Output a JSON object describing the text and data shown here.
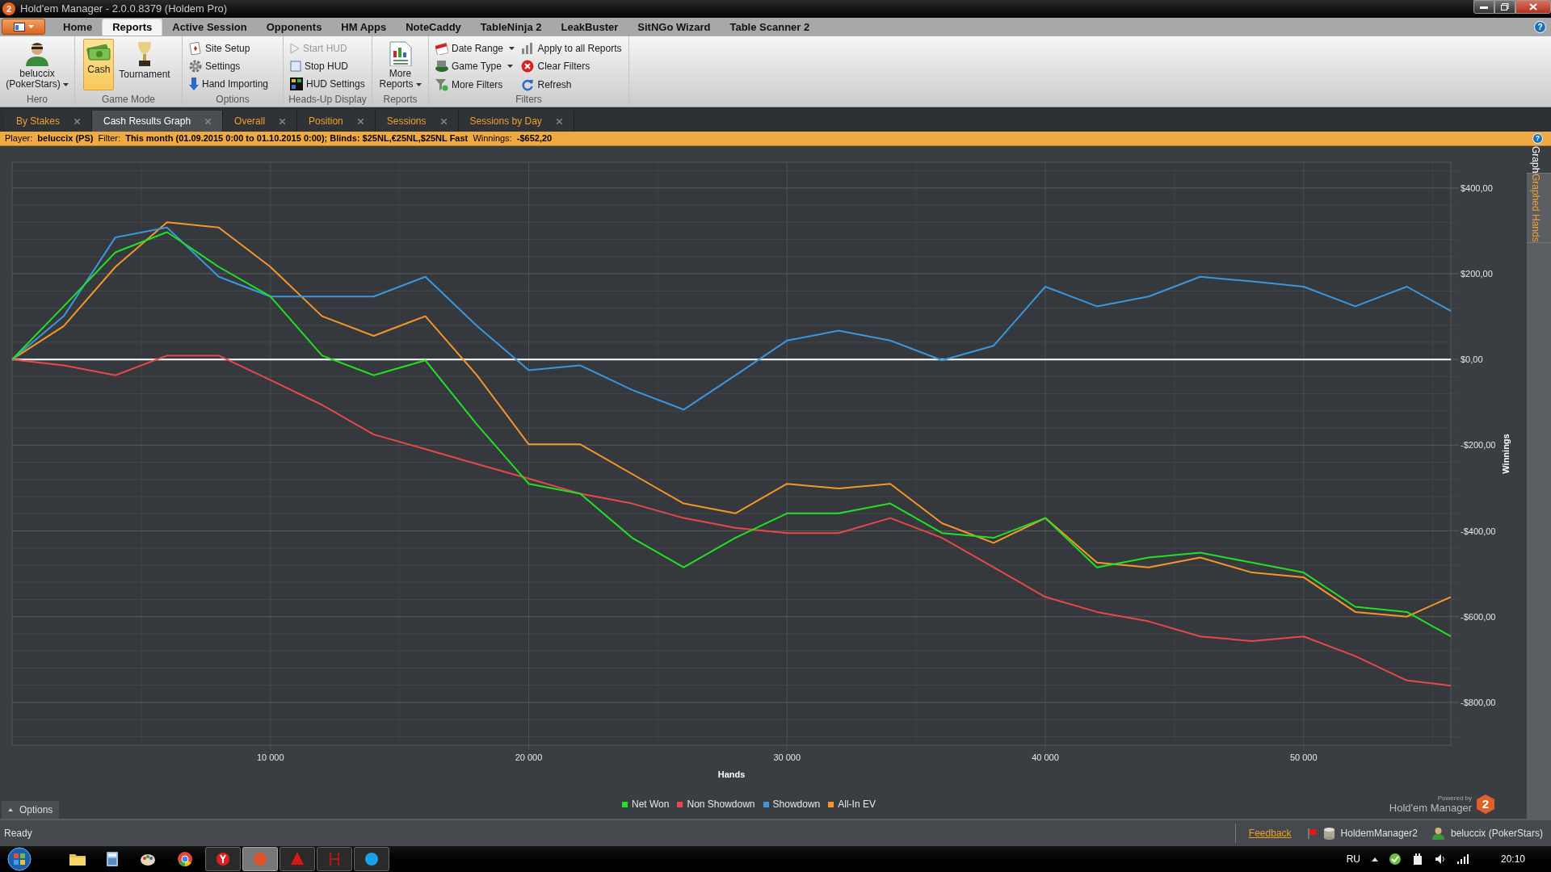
{
  "window": {
    "title": "Hold'em Manager - 2.0.0.8379 (Holdem Pro)",
    "icon_badge": "2"
  },
  "menu_tabs": [
    {
      "label": "Home",
      "selected": false
    },
    {
      "label": "Reports",
      "selected": true
    },
    {
      "label": "Active Session",
      "selected": false
    },
    {
      "label": "Opponents",
      "selected": false
    },
    {
      "label": "HM Apps",
      "selected": false
    },
    {
      "label": "NoteCaddy",
      "selected": false
    },
    {
      "label": "TableNinja 2",
      "selected": false
    },
    {
      "label": "LeakBuster",
      "selected": false
    },
    {
      "label": "SitNGo Wizard",
      "selected": false
    },
    {
      "label": "Table Scanner 2",
      "selected": false
    }
  ],
  "menu_help": "?",
  "ribbon": [
    {
      "label": "Hero",
      "items": [
        {
          "label": "beluccix (PokerStars)",
          "kind": "large",
          "dropdown": true,
          "selected": false,
          "disabled": false
        }
      ]
    },
    {
      "label": "Game Mode",
      "items": [
        {
          "label": "Cash",
          "kind": "large",
          "dropdown": false,
          "selected": true,
          "disabled": false
        },
        {
          "label": "Tournament",
          "kind": "large",
          "dropdown": false,
          "selected": false,
          "disabled": false
        }
      ]
    },
    {
      "label": "Options",
      "items": [
        {
          "label": "Site Setup",
          "kind": "small",
          "dropdown": false,
          "selected": false,
          "disabled": false
        },
        {
          "label": "Settings",
          "kind": "small",
          "dropdown": false,
          "selected": false,
          "disabled": false
        },
        {
          "label": "Hand Importing",
          "kind": "small",
          "dropdown": false,
          "selected": false,
          "disabled": false
        }
      ]
    },
    {
      "label": "Heads-Up Display",
      "items": [
        {
          "label": "Start HUD",
          "kind": "small",
          "dropdown": false,
          "selected": false,
          "disabled": true
        },
        {
          "label": "Stop HUD",
          "kind": "small",
          "dropdown": false,
          "selected": false,
          "disabled": false
        },
        {
          "label": "HUD Settings",
          "kind": "small",
          "dropdown": false,
          "selected": false,
          "disabled": false
        }
      ]
    },
    {
      "label": "Reports",
      "items": [
        {
          "label": "More Reports",
          "kind": "large",
          "dropdown": true,
          "selected": false,
          "disabled": false
        }
      ]
    },
    {
      "label": "Filters",
      "items": [
        {
          "label": "Date Range",
          "kind": "small",
          "dropdown": true,
          "selected": false,
          "disabled": false
        },
        {
          "label": "Game Type",
          "kind": "small",
          "dropdown": true,
          "selected": false,
          "disabled": false
        },
        {
          "label": "More Filters",
          "kind": "small",
          "dropdown": false,
          "selected": false,
          "disabled": false
        },
        {
          "label": "Apply to all Reports",
          "kind": "small",
          "dropdown": false,
          "selected": false,
          "disabled": false
        },
        {
          "label": "Clear Filters",
          "kind": "small",
          "dropdown": false,
          "selected": false,
          "disabled": false
        },
        {
          "label": "Refresh",
          "kind": "small",
          "dropdown": false,
          "selected": false,
          "disabled": false
        }
      ]
    }
  ],
  "doc_tabs": [
    {
      "label": "By Stakes",
      "selected": false
    },
    {
      "label": "Cash Results Graph",
      "selected": true
    },
    {
      "label": "Overall",
      "selected": false
    },
    {
      "label": "Position",
      "selected": false
    },
    {
      "label": "Sessions",
      "selected": false
    },
    {
      "label": "Sessions by Day",
      "selected": false
    }
  ],
  "filter_bar": {
    "text": "Player:  **beluccix (PS)**  Filter:  **This month (01.09.2015 0:00 to 01.10.2015 0:00); Blinds: $25NL,€25NL,$25NL Fast**  Winnings:  **-$652,20**",
    "help": "?"
  },
  "graph": {
    "chart_data": {
      "type": "line",
      "grid": true,
      "xlabel": "Hands",
      "ylabel": "Winnings",
      "xlim": [
        0,
        55700
      ],
      "ylim": [
        -900,
        460
      ],
      "x": [
        0,
        2000,
        4000,
        6000,
        8000,
        10000,
        12000,
        14000,
        16000,
        18000,
        20000,
        22000,
        24000,
        26000,
        28000,
        30000,
        32000,
        34000,
        36000,
        38000,
        40000,
        42000,
        44000,
        46000,
        48000,
        50000,
        52000,
        54000,
        55700
      ],
      "series": [
        {
          "name": "Net Won",
          "color": "#22e022",
          "values": [
            0,
            124,
            250,
            297,
            216,
            147,
            9,
            -37,
            -2,
            -152,
            -290,
            -313,
            -416,
            -485,
            -416,
            -359,
            -359,
            -336,
            -405,
            -416,
            -370,
            -485,
            -462,
            -451,
            -474,
            -497,
            -577,
            -589,
            -646
          ]
        },
        {
          "name": "Non Showdown",
          "color": "#e84848",
          "values": [
            0,
            -14,
            -37,
            9,
            9,
            -48,
            -106,
            -175,
            -209,
            -244,
            -278,
            -313,
            -336,
            -370,
            -393,
            -405,
            -405,
            -370,
            -416,
            -485,
            -554,
            -589,
            -611,
            -646,
            -657,
            -646,
            -692,
            -749,
            -761
          ]
        },
        {
          "name": "Showdown",
          "color": "#3a96dd",
          "values": [
            0,
            101,
            285,
            308,
            193,
            147,
            147,
            147,
            193,
            78,
            -25,
            -14,
            -71,
            -117,
            -37,
            44,
            67,
            44,
            -2,
            32,
            170,
            124,
            147,
            193,
            182,
            170,
            124,
            170,
            113
          ]
        },
        {
          "name": "All-In EV",
          "color": "#f5962a",
          "values": [
            0,
            78,
            216,
            320,
            308,
            216,
            101,
            55,
            101,
            -37,
            -198,
            -198,
            -267,
            -336,
            -359,
            -290,
            -301,
            -290,
            -382,
            -428,
            -370,
            -474,
            -485,
            -462,
            -497,
            -508,
            -589,
            -600,
            -554
          ]
        }
      ],
      "xticks": [
        {
          "value": 10000,
          "label": "10 000"
        },
        {
          "value": 20000,
          "label": "20 000"
        },
        {
          "value": 30000,
          "label": "30 000"
        },
        {
          "value": 40000,
          "label": "40 000"
        },
        {
          "value": 50000,
          "label": "50 000"
        }
      ],
      "yticks": [
        {
          "value": 400,
          "label": "$400,00"
        },
        {
          "value": 200,
          "label": "$200,00"
        },
        {
          "value": 0,
          "label": "$0,00"
        },
        {
          "value": -200,
          "label": "-$200,00"
        },
        {
          "value": -400,
          "label": "-$400,00"
        },
        {
          "value": -600,
          "label": "-$600,00"
        },
        {
          "value": -800,
          "label": "-$800,00"
        }
      ]
    },
    "options_button": "Options",
    "powered_by": "Powered by",
    "product": "Hold'em Manager",
    "badge": "2"
  },
  "side_tabs": [
    {
      "label": "Graph",
      "selected": true
    },
    {
      "label": "Graphed Hands",
      "selected": false
    }
  ],
  "status_bar": {
    "text": "Ready",
    "feedback": "Feedback",
    "database": "HoldemManager2",
    "player": "beluccix (PokerStars)"
  },
  "taskbar": {
    "language": "RU",
    "clock": "20:10"
  }
}
